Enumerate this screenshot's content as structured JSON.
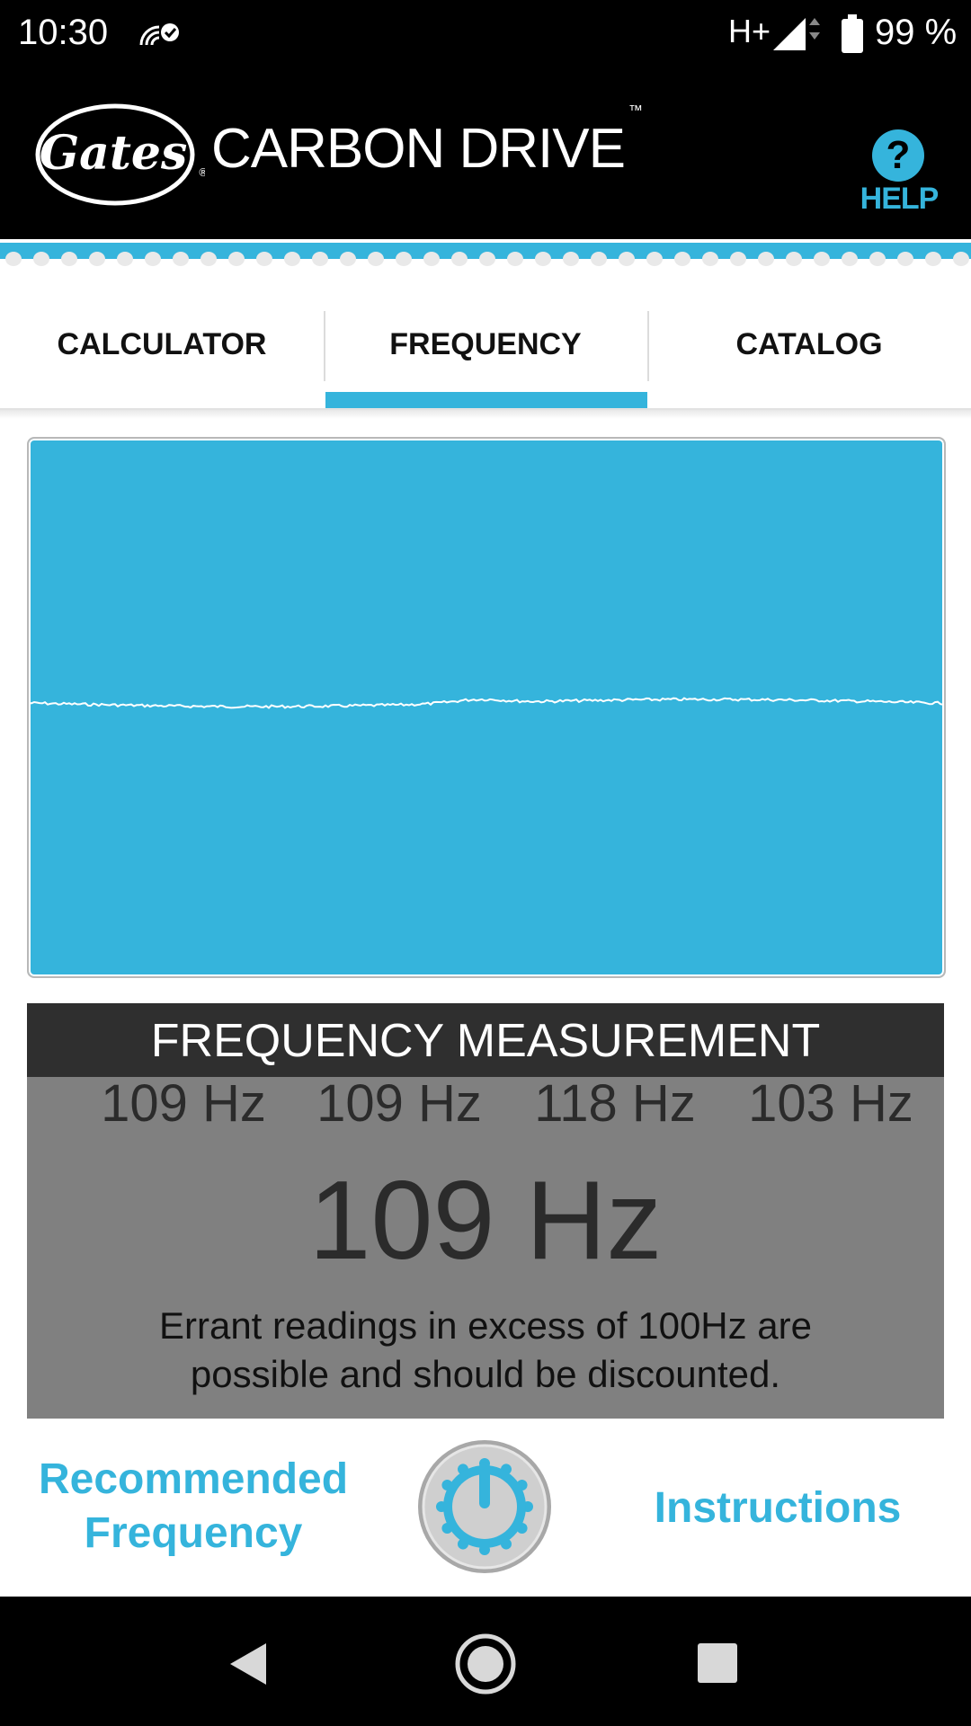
{
  "status_bar": {
    "time": "10:30",
    "network": "H+",
    "battery_percent": "99 %"
  },
  "header": {
    "logo_text": "Gates",
    "brand": "CARBON DRIVE",
    "trademark": "™",
    "help_symbol": "?",
    "help_label": "HELP"
  },
  "tabs": [
    {
      "label": "CALCULATOR",
      "active": false
    },
    {
      "label": "FREQUENCY",
      "active": true
    },
    {
      "label": "CATALOG",
      "active": false
    }
  ],
  "measurement": {
    "title": "FREQUENCY MEASUREMENT",
    "recent_readings": [
      "109 Hz",
      "109 Hz",
      "118 Hz",
      "103 Hz"
    ],
    "current_reading": "109 Hz",
    "note_line1": "Errant readings in excess of 100Hz are",
    "note_line2": "possible and should be discounted."
  },
  "actions": {
    "recommended_line1": "Recommended",
    "recommended_line2": "Frequency",
    "power_button": "power-icon",
    "instructions": "Instructions"
  },
  "colors": {
    "accent": "#35b4dc",
    "header_bg": "#000000",
    "measurement_header": "#2f2f2f",
    "measurement_body": "#808080"
  },
  "icons": {
    "back": "back-triangle-icon",
    "home": "home-circle-icon",
    "recents": "recents-square-icon"
  }
}
